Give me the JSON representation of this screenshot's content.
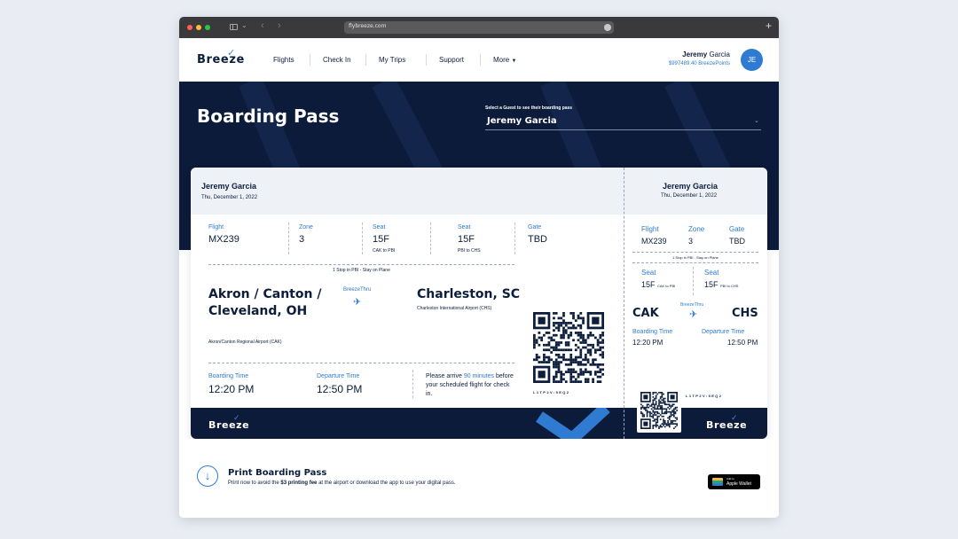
{
  "browser": {
    "url": "flybreeze.com"
  },
  "nav": {
    "logo": "Breeze",
    "items": [
      "Flights",
      "Check In",
      "My Trips",
      "Support",
      "More"
    ],
    "user_first": "Jeremy",
    "user_last": "Garcia",
    "points": "$997489.40 BreezePoints",
    "avatar": "JE"
  },
  "hero": {
    "title": "Boarding Pass",
    "select_label": "Select a Guest to see their boarding pass",
    "select_value": "Jeremy Garcia"
  },
  "pass": {
    "name": "Jeremy Garcia",
    "date": "Thu, December 1, 2022",
    "flight_label": "Flight",
    "flight": "MX239",
    "zone_label": "Zone",
    "zone": "3",
    "seat_label": "Seat",
    "seat1": "15F",
    "seat1_route": "CAK to PBI",
    "seat2": "15F",
    "seat2_route": "PBI to CHS",
    "gate_label": "Gate",
    "gate": "TBD",
    "stop_note": "1 Stop in PBI - Stay on Plane",
    "origin_city": "Akron / Canton / Cleveland, OH",
    "origin_airport": "Akron/Canton Regional Airport (CAK)",
    "via": "BreezeThru",
    "dest_city": "Charleston, SC",
    "dest_airport": "Charleston International Airport (CHS)",
    "boarding_label": "Boarding Time",
    "boarding": "12:20 PM",
    "departure_label": "Departure Time",
    "departure": "12:50 PM",
    "arrive_pre": "Please arrive",
    "arrive_hl": "90 minutes",
    "arrive_post": "before your scheduled flight for check in.",
    "confirmation": "L1TP2V:5EQ2",
    "footer_logo": "Breeze"
  },
  "stub": {
    "name": "Jeremy Garcia",
    "date": "Thu, December 1, 2022",
    "flight_label": "Flight",
    "flight": "MX239",
    "zone_label": "Zone",
    "zone": "3",
    "gate_label": "Gate",
    "gate": "TBD",
    "stop_note": "1 Stop in PBI - Stay on Plane",
    "seat_label": "Seat",
    "seat1": "15F",
    "seat1_route": "CAK to PBI",
    "seat2": "15F",
    "seat2_route": "PBI to CHS",
    "origin_code": "CAK",
    "via": "BreezeThru",
    "dest_code": "CHS",
    "boarding_label": "Boarding Time",
    "boarding": "12:20 PM",
    "departure_label": "Departure Time",
    "departure": "12:50 PM",
    "confirmation": "L1TP2V:5EQ2",
    "footer_logo": "Breeze"
  },
  "print": {
    "title": "Print Boarding Pass",
    "sub_pre": "Print now to avoid the",
    "sub_bold": "$3 printing fee",
    "sub_post": "at the airport or download the app to use your digital pass.",
    "wallet_line1": "Add to",
    "wallet_line2": "Apple Wallet"
  }
}
